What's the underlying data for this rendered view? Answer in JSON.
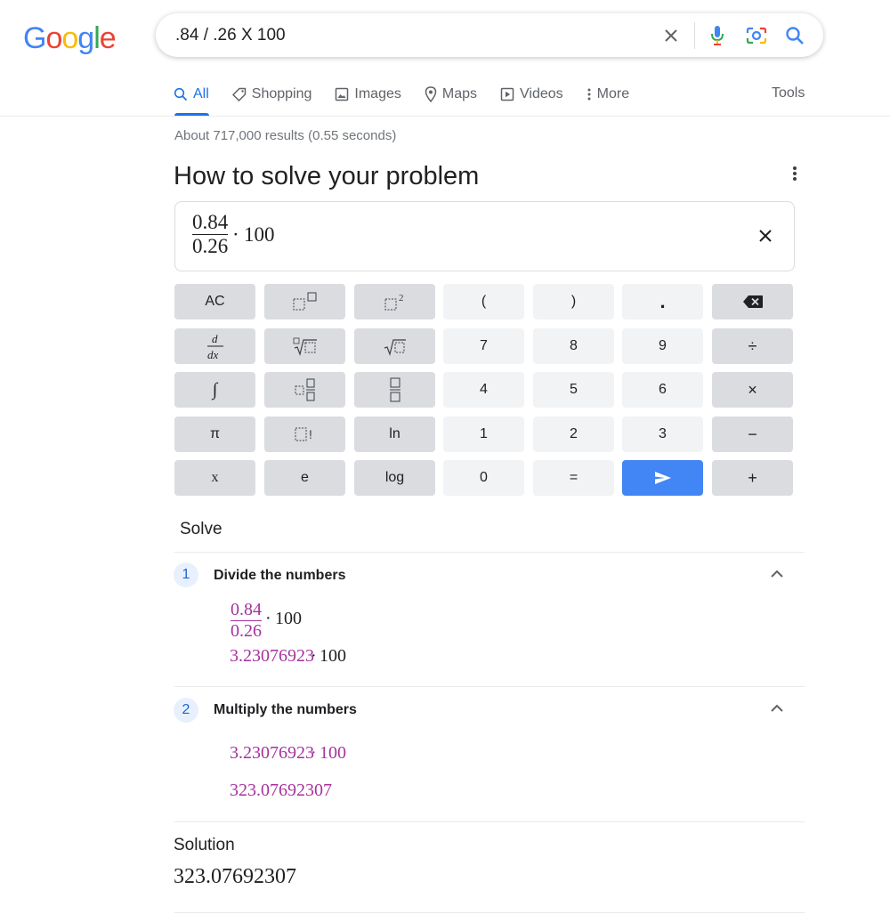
{
  "search": {
    "query": ".84 / .26 X 100"
  },
  "logo": [
    "G",
    "o",
    "o",
    "g",
    "l",
    "e"
  ],
  "tabs": [
    {
      "label": "All",
      "icon": "search-icon",
      "active": true
    },
    {
      "label": "Shopping",
      "icon": "tag-icon"
    },
    {
      "label": "Images",
      "icon": "image-icon"
    },
    {
      "label": "Maps",
      "icon": "map-pin-icon"
    },
    {
      "label": "Videos",
      "icon": "play-icon"
    },
    {
      "label": "More",
      "icon": "more-vert-icon"
    }
  ],
  "tools_label": "Tools",
  "result_stats": "About 717,000 results (0.55 seconds)",
  "panel_title": "How to solve your problem",
  "display": {
    "numerator": "0.84",
    "denominator": "0.26",
    "dot": "·",
    "multiplier": "100"
  },
  "keypad": {
    "row1": [
      "AC",
      "□□",
      "□2",
      "(",
      ")",
      ".",
      "⌫"
    ],
    "row2": [
      "d/dx",
      "n√□",
      "√□",
      "7",
      "8",
      "9",
      "÷"
    ],
    "row3": [
      "∫",
      "□ □/□",
      "□/□",
      "4",
      "5",
      "6",
      "×"
    ],
    "row4": [
      "π",
      "□!",
      "ln",
      "1",
      "2",
      "3",
      "−"
    ],
    "row5": [
      "x",
      "e",
      "log",
      "0",
      "=",
      "send",
      "+"
    ]
  },
  "solve_label": "Solve",
  "steps": [
    {
      "number": "1",
      "title": "Divide the numbers",
      "numerator": "0.84",
      "denominator": "0.26",
      "dot": "·",
      "multiplier": "100",
      "result": "3.23076923",
      "result_dot": "·",
      "result_multiplier": "100"
    },
    {
      "number": "2",
      "title": "Multiply the numbers",
      "lhs": "3.23076923",
      "dot": "·",
      "multiplier": "100",
      "result": "323.07692307"
    }
  ],
  "solution_label": "Solution",
  "solution_value": "323.07692307",
  "colors": {
    "accent": "#1a73e8",
    "step_highlight": "#a5329d",
    "send_button": "#4285f4"
  }
}
